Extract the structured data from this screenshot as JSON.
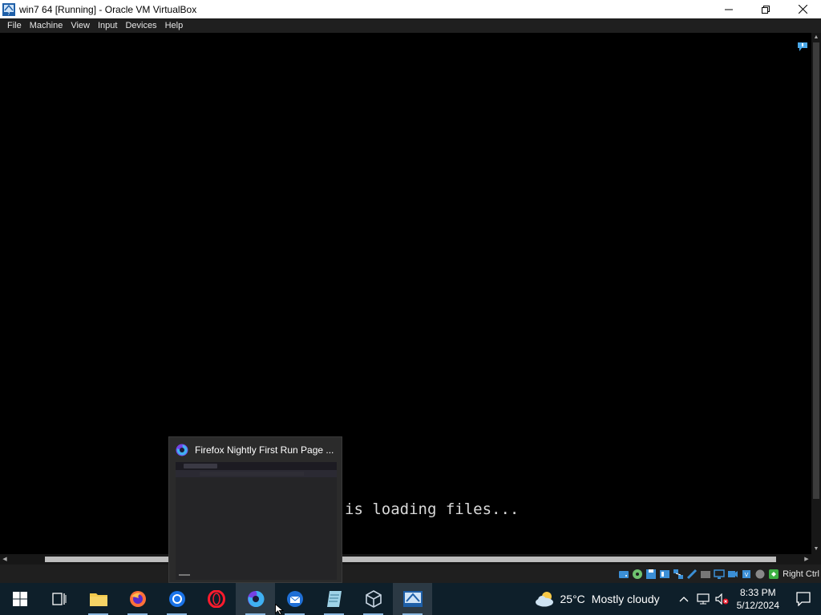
{
  "window": {
    "title": "win7 64 [Running] - Oracle VM VirtualBox",
    "minimize_icon": "minimize-icon",
    "maximize_icon": "restore-icon",
    "close_icon": "close-icon"
  },
  "menu": {
    "items": [
      "File",
      "Machine",
      "View",
      "Input",
      "Devices",
      "Help"
    ]
  },
  "vm": {
    "console_text": "is loading files..."
  },
  "statusbar": {
    "host_key": "Right Ctrl",
    "icons": [
      "hard-disk-icon",
      "optical-drive-icon",
      "floppy-icon",
      "audio-icon",
      "network-icon",
      "usb-icon",
      "shared-folders-icon",
      "display-icon",
      "video-capture-icon",
      "cpu-icon",
      "mouse-integration-icon",
      "keyboard-icon"
    ]
  },
  "taskbar_preview": {
    "title": "Firefox Nightly First Run Page ..."
  },
  "taskbar": {
    "apps": [
      "start-icon",
      "task-view-icon",
      "file-explorer-icon",
      "firefox-icon",
      "chrome-icon",
      "opera-icon",
      "firefox-nightly-icon",
      "thunderbird-icon",
      "notepad-icon",
      "virtualbox-icon",
      "virtualbox-vm-icon"
    ],
    "weather": {
      "temperature": "25°C",
      "description": "Mostly cloudy"
    },
    "clock": {
      "time": "8:33 PM",
      "date": "5/12/2024"
    }
  },
  "colors": {
    "taskbar": "#0e1f2a",
    "menubar": "#1f1f1f",
    "accent": "#8bb8e0"
  }
}
